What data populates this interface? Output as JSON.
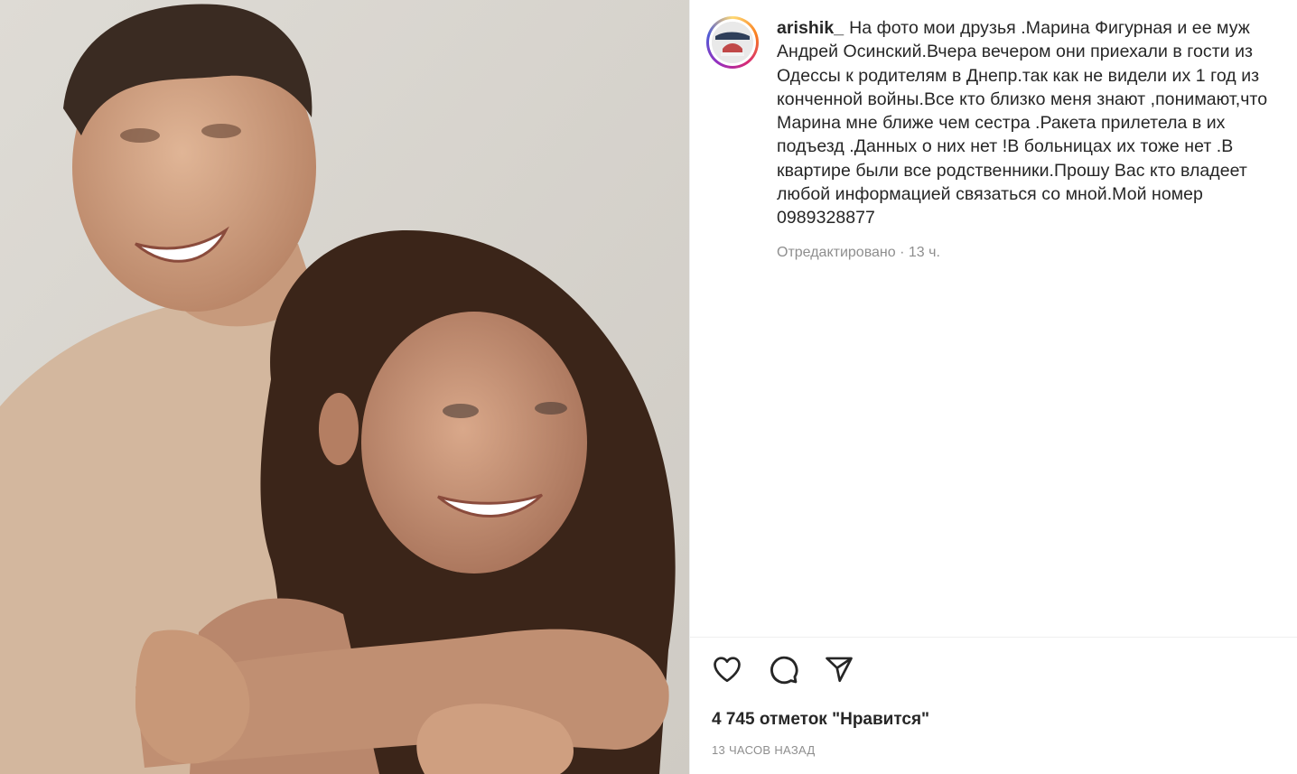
{
  "post": {
    "username": "arishik_",
    "caption": "На фото мои друзья .Марина Фигурная и ее муж\nАндрей Осинский.Вчера вечером они приехали в гости из\nОдессы к родителям в Днепр.так как не видели их 1 год из\nконченной войны.Все кто близко меня знают ,понимают,что\nМарина мне ближе чем сестра .Ракета прилетела в их\nподъезд .Данных о них нет !В больницах их тоже нет .В\nквартире были все родственники.Прошу Вас кто владеет\nлюбой информацией связаться со мной.Мой номер\n0989328877",
    "edited_label": "Отредактировано",
    "separator": "·",
    "edited_time": "13 ч.",
    "likes": "4 745 отметок \"Нравится\"",
    "posted_ago": "13 часов назад"
  },
  "icons": {
    "like": "heart-outline-icon",
    "comment": "comment-bubble-icon",
    "share": "paper-plane-icon",
    "avatar": "profile-avatar"
  },
  "colors": {
    "text": "#262626",
    "muted": "#8e8e8e",
    "divider": "#efefef",
    "story_ring": [
      "#feda75",
      "#fa7e1e",
      "#d62976",
      "#962fbf",
      "#4f5bd5"
    ]
  }
}
